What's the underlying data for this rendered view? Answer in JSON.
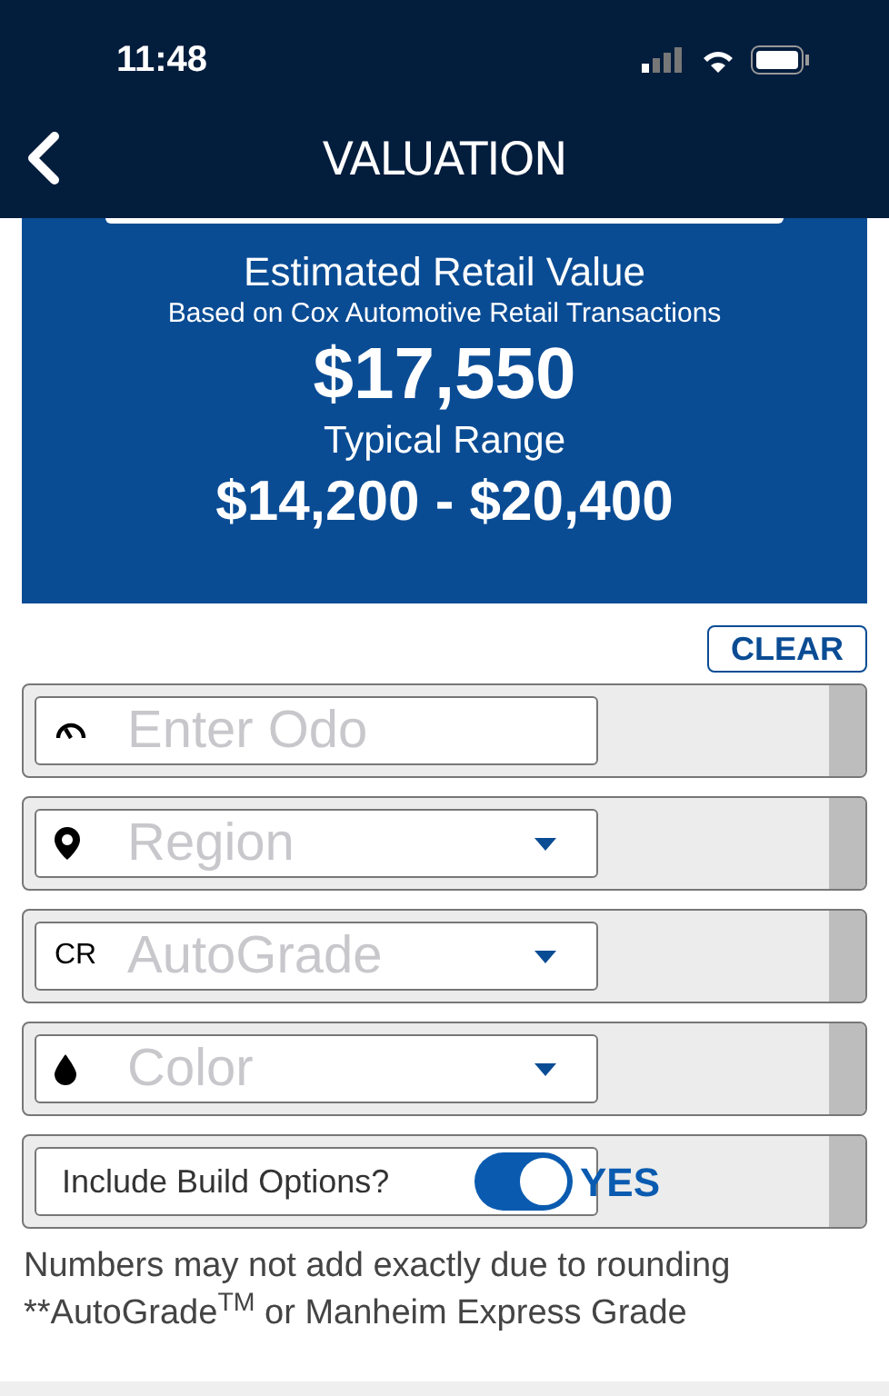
{
  "status_bar": {
    "time": "11:48"
  },
  "nav": {
    "title": "VALUATION"
  },
  "value_panel": {
    "title": "Estimated Retail Value",
    "subtitle": "Based on Cox Automotive Retail Transactions",
    "value": "$17,550",
    "range_label": "Typical Range",
    "range": "$14,200 - $20,400"
  },
  "clear_button": "CLEAR",
  "fields": [
    {
      "kind": "text",
      "placeholder": "Enter Odo"
    },
    {
      "kind": "select",
      "placeholder": "Region"
    },
    {
      "kind": "select",
      "placeholder": "AutoGrade",
      "prefix": "CR"
    },
    {
      "kind": "select",
      "placeholder": "Color"
    }
  ],
  "build_options": {
    "label": "Include Build Options?",
    "on": true,
    "value": "YES"
  },
  "notes": [
    "Numbers may not add exactly due to rounding",
    "**AutoGrade$^{TM}$  or Manheim Express Grade"
  ]
}
